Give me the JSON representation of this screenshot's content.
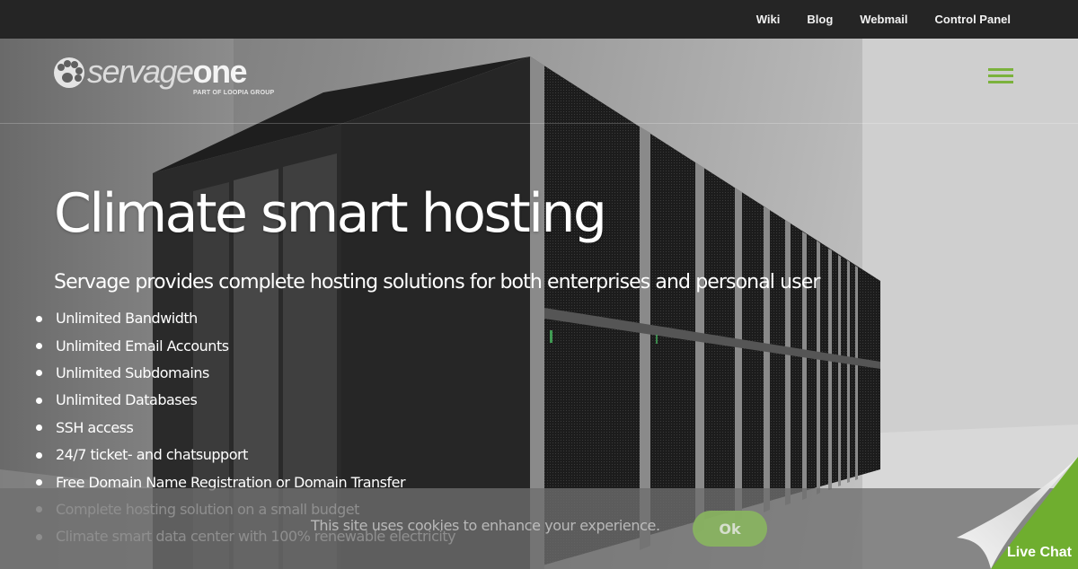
{
  "topnav": {
    "items": [
      {
        "label": "Wiki"
      },
      {
        "label": "Blog"
      },
      {
        "label": "Webmail"
      },
      {
        "label": "Control Panel"
      }
    ]
  },
  "header": {
    "logo_primary": "servage",
    "logo_secondary": "one",
    "logo_tagline": "PART OF LOOPIA GROUP",
    "menu_icon": "hamburger-icon",
    "accent_color": "#7bb23c"
  },
  "hero": {
    "title": "Climate smart hosting",
    "subtitle": "Servage provides complete hosting solutions for both enterprises and personal user",
    "features": [
      "Unlimited Bandwidth",
      "Unlimited Email Accounts",
      "Unlimited Subdomains",
      "Unlimited Databases",
      "SSH access",
      "24/7 ticket- and chatsupport",
      "Free Domain Name Registration or Domain Transfer",
      "Complete hosting solution on a small budget",
      "Climate smart data center with 100% renewable electricity"
    ]
  },
  "cookie_banner": {
    "message": "This site uses cookies to enhance your experience.",
    "ok_label": "Ok"
  },
  "live_chat": {
    "label": "Live Chat",
    "color": "#6fae2f"
  }
}
